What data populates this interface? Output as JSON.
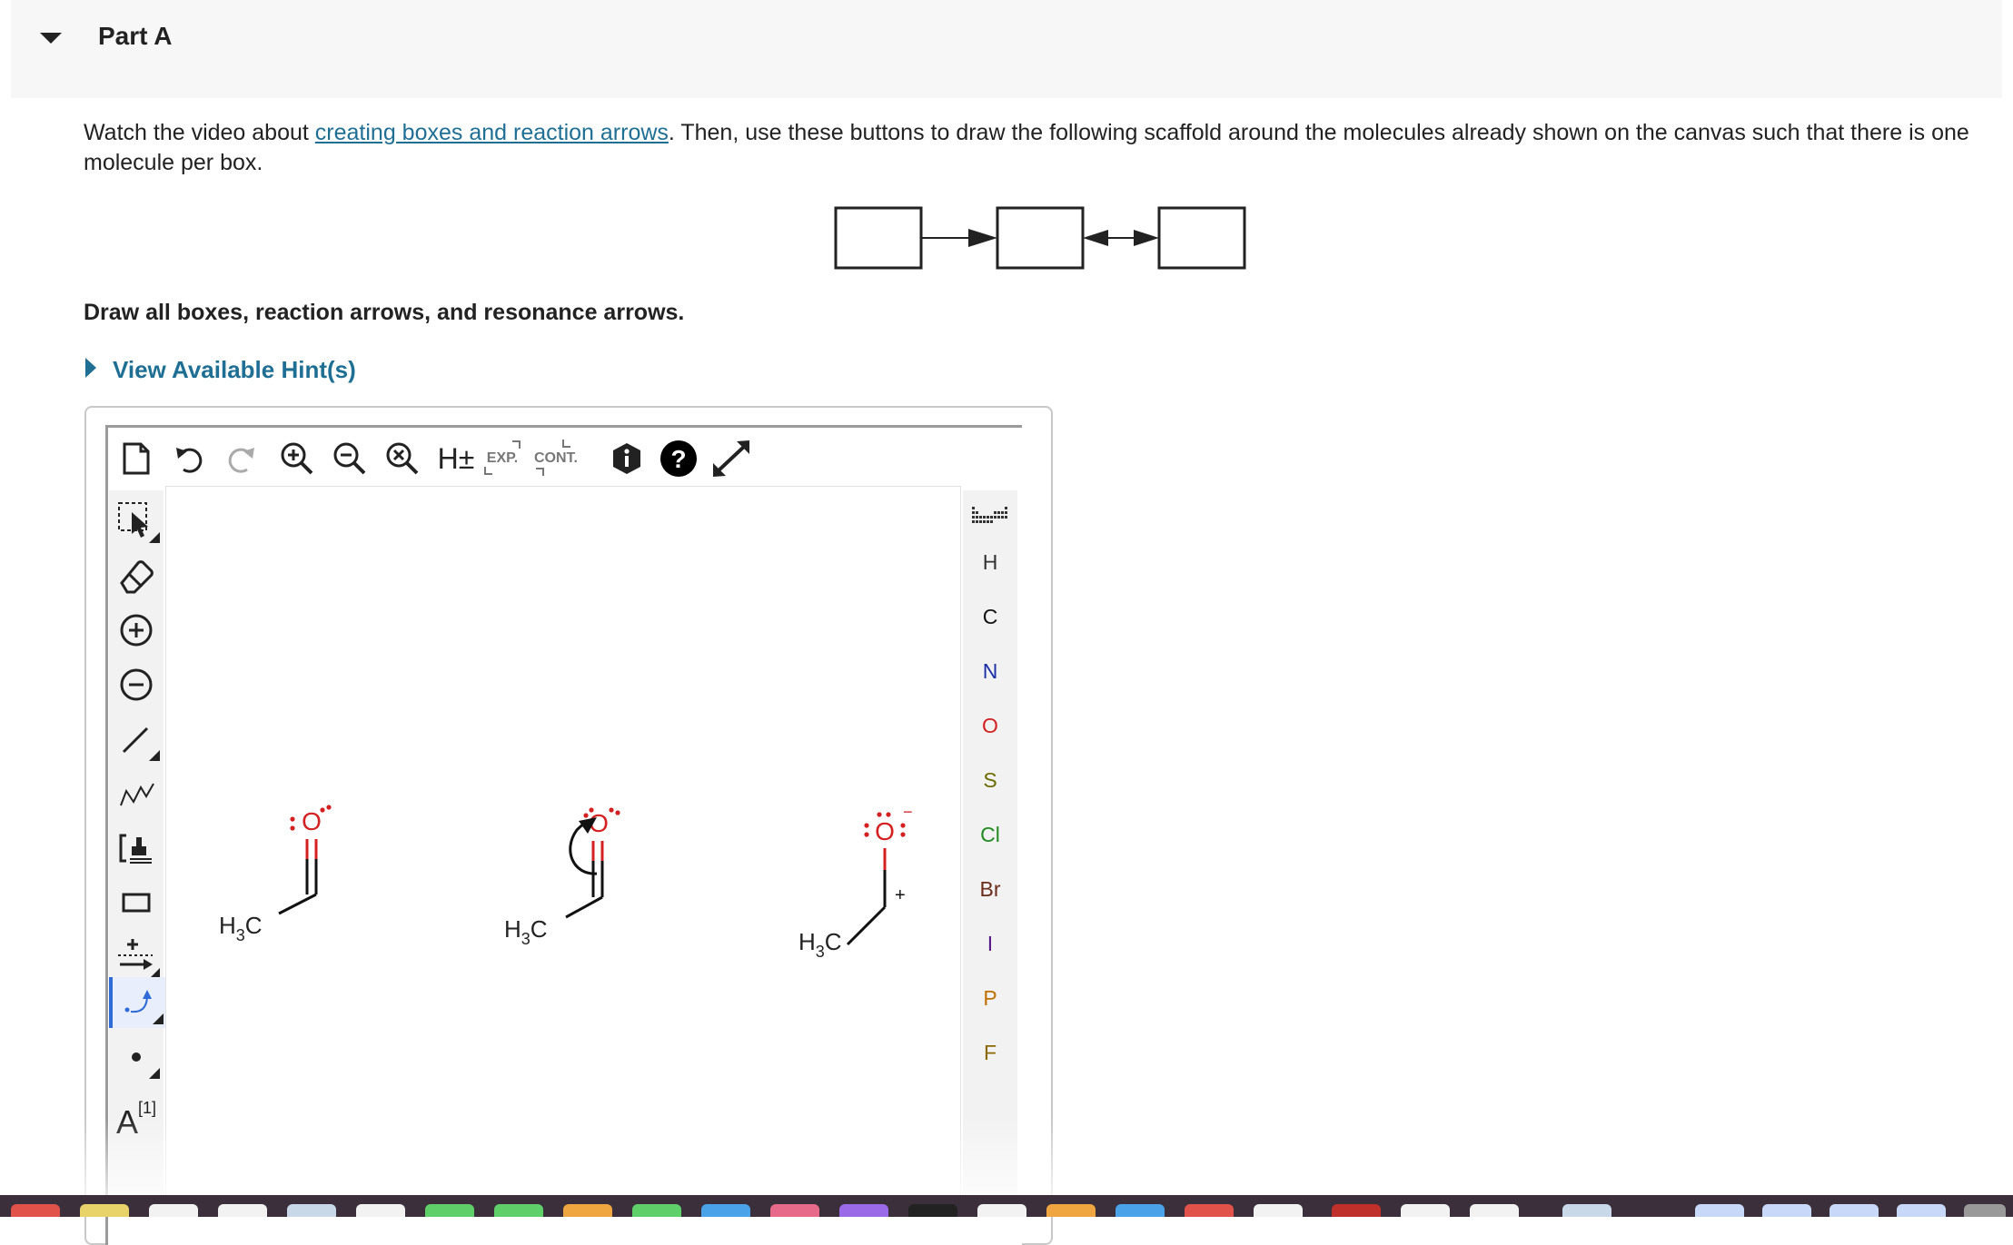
{
  "part": {
    "title": "Part A"
  },
  "instructions": {
    "before_link": "Watch the video about ",
    "link_text": "creating boxes and reaction arrows",
    "after_link": ". Then, use these buttons to draw the following scaffold around the molecules already shown on the canvas such that there is one molecule per box."
  },
  "task": {
    "text": "Draw all boxes, reaction arrows, and resonance arrows."
  },
  "hints": {
    "label": "View Available Hint(s)"
  },
  "toolbar": {
    "expand_label": "EXP.",
    "contract_label": "CONT.",
    "h_toggle_label": "H±"
  },
  "left_toolbar": {
    "text_tool_label": "A",
    "text_tool_superscript": "[1]"
  },
  "elements": [
    {
      "symbol": "H",
      "color": "#333333"
    },
    {
      "symbol": "C",
      "color": "#111111"
    },
    {
      "symbol": "N",
      "color": "#1a2fa8"
    },
    {
      "symbol": "O",
      "color": "#d42020"
    },
    {
      "symbol": "S",
      "color": "#6b6b00"
    },
    {
      "symbol": "Cl",
      "color": "#1f8a1f"
    },
    {
      "symbol": "Br",
      "color": "#6b2a1a"
    },
    {
      "symbol": "I",
      "color": "#5a1a8a"
    },
    {
      "symbol": "P",
      "color": "#c07000"
    },
    {
      "symbol": "F",
      "color": "#8a6a00"
    }
  ],
  "molecules": {
    "m1": {
      "oxygen": "O",
      "methyl": "H3C"
    },
    "m2": {
      "oxygen": "O",
      "methyl": "H3C"
    },
    "m3": {
      "oxygen": "O",
      "methyl": "H3C",
      "oxygen_charge": "−",
      "carbon_charge": "+"
    }
  },
  "colors": {
    "link": "#1f6f95",
    "active_tool": "#2e6bd6",
    "oxygen": "#d42020"
  }
}
